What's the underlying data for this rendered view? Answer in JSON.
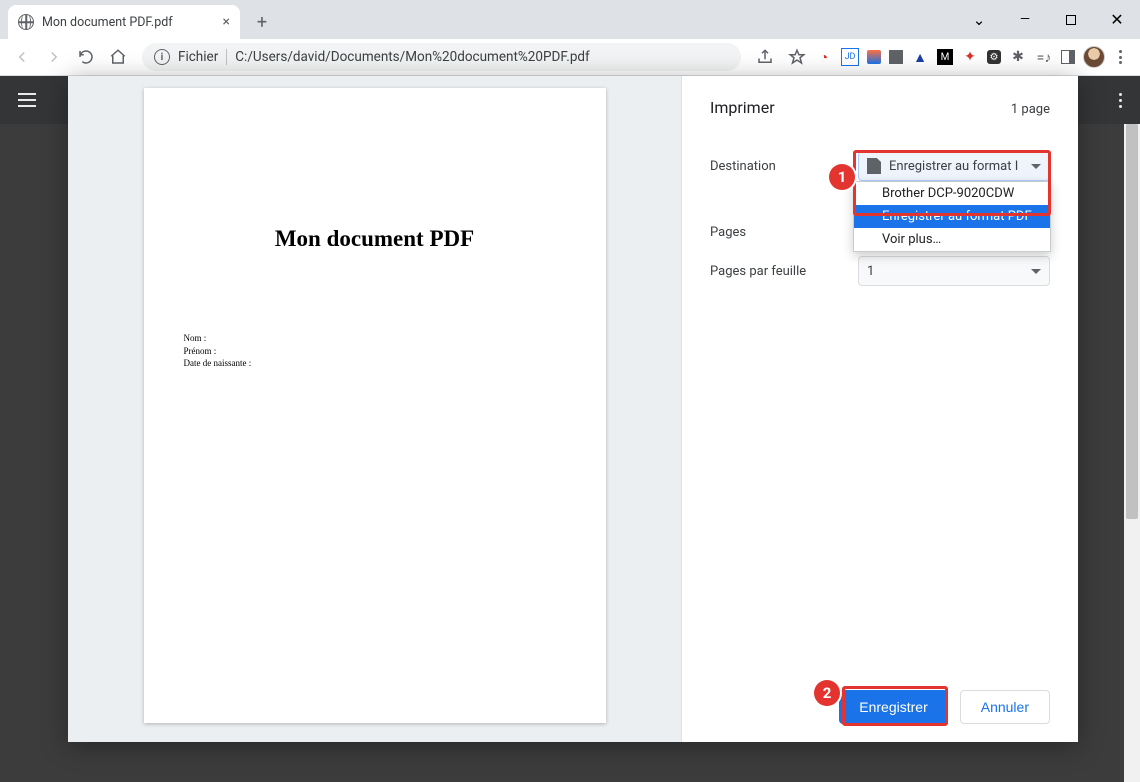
{
  "tab": {
    "title": "Mon document PDF.pdf"
  },
  "address": {
    "scheme_label": "Fichier",
    "path": "C:/Users/david/Documents/Mon%20document%20PDF.pdf"
  },
  "preview": {
    "doc_title": "Mon document PDF",
    "fields": [
      "Nom :",
      "Prénom :",
      "Date de naissante :"
    ]
  },
  "print": {
    "title": "Imprimer",
    "page_count": "1 page",
    "rows": {
      "destination_label": "Destination",
      "pages_label": "Pages",
      "ppf_label": "Pages par feuille",
      "ppf_value": "1"
    },
    "destination_select": {
      "display": "Enregistrer au format I",
      "options": [
        "Brother DCP-9020CDW",
        "Enregistrer au format PDF",
        "Voir plus…"
      ],
      "selected_index": 1
    },
    "buttons": {
      "save": "Enregistrer",
      "cancel": "Annuler"
    }
  },
  "markers": {
    "one": "1",
    "two": "2"
  }
}
